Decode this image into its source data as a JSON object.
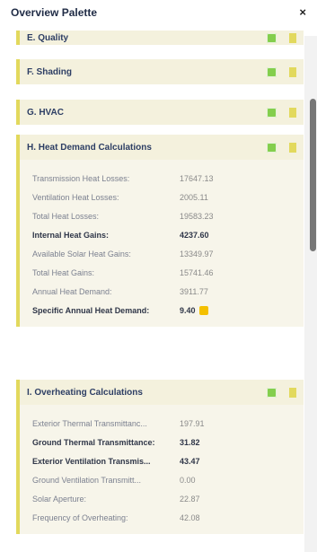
{
  "window": {
    "title": "Overview Palette",
    "close_symbol": "×"
  },
  "sections": {
    "quality": "E. Quality",
    "shading": "F. Shading",
    "hvac": "G. HVAC",
    "heat_demand": "H. Heat Demand Calculations",
    "overheating": "I. Overheating Calculations"
  },
  "heat_demand_rows": [
    {
      "label": "Transmission Heat Losses:",
      "value": "17647.13"
    },
    {
      "label": "Ventilation Heat Losses:",
      "value": "2005.11"
    },
    {
      "label": "Total Heat Losses:",
      "value": "19583.23"
    },
    {
      "label": "Internal Heat Gains:",
      "value": "4237.60"
    },
    {
      "label": "Available Solar Heat Gains:",
      "value": "13349.97"
    },
    {
      "label": "Total Heat Gains:",
      "value": "15741.46"
    },
    {
      "label": "Annual Heat Demand:",
      "value": "3911.77"
    },
    {
      "label": "Specific Annual Heat Demand:",
      "value": "9.40"
    }
  ],
  "overheating_rows": [
    {
      "label": "Exterior Thermal Transmittanc...",
      "value": "197.91"
    },
    {
      "label": "Ground Thermal Transmittance:",
      "value": "31.82"
    },
    {
      "label": "Exterior Ventilation Transmis...",
      "value": "43.47"
    },
    {
      "label": "Ground Ventilation Transmitt...",
      "value": "0.00"
    },
    {
      "label": "Solar Aperture:",
      "value": "22.87"
    },
    {
      "label": "Frequency of Overheating:",
      "value": "42.08"
    }
  ]
}
